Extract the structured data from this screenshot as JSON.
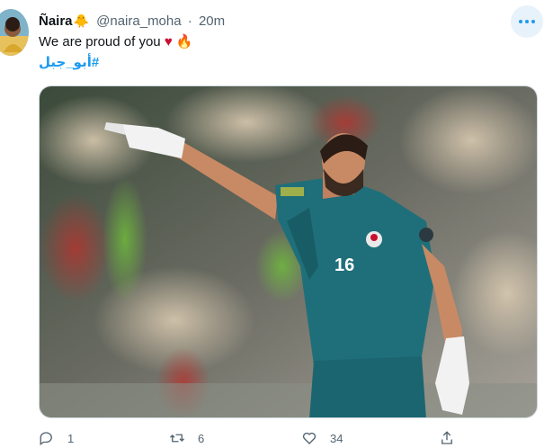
{
  "tweet": {
    "display_name": "Ñaira",
    "name_emoji": "🐥",
    "handle": "@naira_moha",
    "separator": "·",
    "time": "20m",
    "text": "We are proud of you",
    "text_emoji_1": "♥",
    "text_emoji_2": "🔥",
    "hashtag": "#أبو_جبل",
    "actions": {
      "reply_count": "1",
      "retweet_count": "6",
      "like_count": "34"
    }
  },
  "icons": [
    "avatar",
    "more-icon",
    "reply-icon",
    "retweet-icon",
    "like-icon",
    "share-icon"
  ],
  "colors": {
    "accent": "#1d9bf0",
    "jersey": "#1f6f7a",
    "heart": "#c8102e",
    "fire": "#f4900c"
  }
}
